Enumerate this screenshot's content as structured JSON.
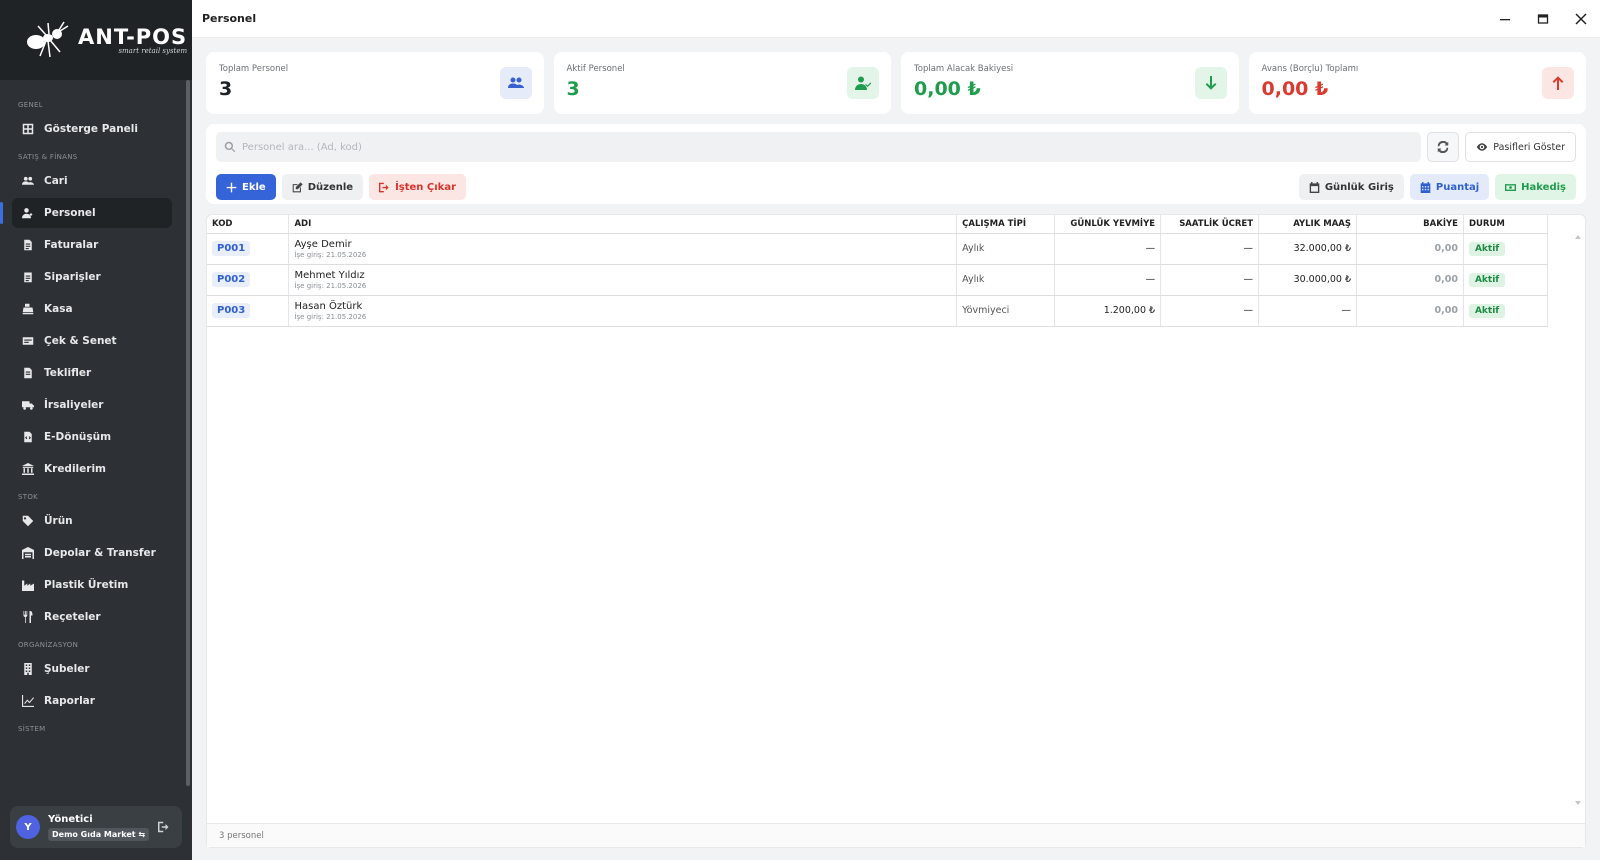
{
  "app": {
    "logo_title": "ANT-POS",
    "logo_subtitle": "smart retail system",
    "page_title": "Personel"
  },
  "sidebar": {
    "sections": {
      "genel": "GENEL",
      "satis": "SATIŞ & FİNANS",
      "stok": "STOK",
      "org": "ORGANİZASYON",
      "sistem": "SİSTEM"
    },
    "items": {
      "dashboard": "Gösterge Paneli",
      "cari": "Cari",
      "personel": "Personel",
      "faturalar": "Faturalar",
      "siparisler": "Siparişler",
      "kasa": "Kasa",
      "cek": "Çek & Senet",
      "teklifler": "Teklifler",
      "irsaliyeler": "İrsaliyeler",
      "edonusum": "E-Dönüşüm",
      "kredilerim": "Kredilerim",
      "urun": "Ürün",
      "depolar": "Depolar & Transfer",
      "plastik": "Plastik Üretim",
      "receteler": "Reçeteler",
      "subeler": "Şubeler",
      "raporlar": "Raporlar"
    },
    "user": {
      "initial": "Y",
      "name": "Yönetici",
      "company": "Demo Gıda Market ⇆"
    }
  },
  "stats": [
    {
      "label": "Toplam Personel",
      "value": "3",
      "color": "#1e2226",
      "icon": "users-icon"
    },
    {
      "label": "Aktif Personel",
      "value": "3",
      "color": "#1f9d4c",
      "icon": "user-check-icon"
    },
    {
      "label": "Toplam Alacak Bakiyesi",
      "value": "0,00 ₺",
      "color": "#1f9d4c",
      "icon": "arrow-down-icon"
    },
    {
      "label": "Avans (Borçlu) Toplamı",
      "value": "0,00 ₺",
      "color": "#dc3a2e",
      "icon": "arrow-up-icon"
    }
  ],
  "toolbar": {
    "search_placeholder": "Personel ara... (Ad, kod)",
    "show_passive": "Pasifleri Göster",
    "add": "Ekle",
    "edit": "Düzenle",
    "dismiss": "İşten Çıkar",
    "daily_entry": "Günlük Giriş",
    "timesheet": "Puantaj",
    "earnings": "Hakediş"
  },
  "table": {
    "columns": [
      "KOD",
      "ADI",
      "ÇALIŞMA TİPİ",
      "GÜNLÜK YEVMİYE",
      "SAATLİK ÜCRET",
      "AYLIK MAAŞ",
      "BAKİYE",
      "DURUM"
    ],
    "rows": [
      {
        "code": "P001",
        "name": "Ayşe Demir",
        "start": "İşe giriş: 21.05.2026",
        "type": "Aylık",
        "daily": "—",
        "hourly": "—",
        "monthly": "32.000,00 ₺",
        "balance": "0,00",
        "status": "Aktif"
      },
      {
        "code": "P002",
        "name": "Mehmet Yıldız",
        "start": "İşe giriş: 21.05.2026",
        "type": "Aylık",
        "daily": "—",
        "hourly": "—",
        "monthly": "30.000,00 ₺",
        "balance": "0,00",
        "status": "Aktif"
      },
      {
        "code": "P003",
        "name": "Hasan Öztürk",
        "start": "İşe giriş: 21.05.2026",
        "type": "Yövmiyeci",
        "daily": "1.200,00 ₺",
        "hourly": "—",
        "monthly": "—",
        "balance": "0,00",
        "status": "Aktif"
      }
    ],
    "footer": "3 personel"
  }
}
